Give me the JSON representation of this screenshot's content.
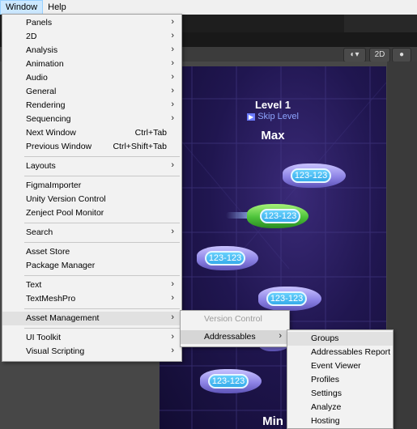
{
  "menubar": {
    "items": [
      "Window",
      "Help"
    ]
  },
  "toolbar": {
    "btn_2d": "2D"
  },
  "game": {
    "level_title": "Level 1",
    "skip_label": "Skip Level",
    "top_label": "Max",
    "bottom_label": "Min",
    "ship_labels": [
      "123-123",
      "123-123",
      "123-123",
      "123-123",
      "123-123"
    ]
  },
  "window_menu": {
    "items": [
      {
        "label": "Panels",
        "submenu": true
      },
      {
        "label": "2D",
        "submenu": true
      },
      {
        "label": "Analysis",
        "submenu": true
      },
      {
        "label": "Animation",
        "submenu": true
      },
      {
        "label": "Audio",
        "submenu": true
      },
      {
        "label": "General",
        "submenu": true
      },
      {
        "label": "Rendering",
        "submenu": true
      },
      {
        "label": "Sequencing",
        "submenu": true
      },
      {
        "label": "Next Window",
        "shortcut": "Ctrl+Tab"
      },
      {
        "label": "Previous Window",
        "shortcut": "Ctrl+Shift+Tab"
      },
      {
        "label": "Layouts",
        "submenu": true
      },
      {
        "label": "FigmaImporter"
      },
      {
        "label": "Unity Version Control"
      },
      {
        "label": "Zenject Pool Monitor"
      },
      {
        "label": "Search",
        "submenu": true
      },
      {
        "label": "Asset Store"
      },
      {
        "label": "Package Manager"
      },
      {
        "label": "Text",
        "submenu": true
      },
      {
        "label": "TextMeshPro",
        "submenu": true
      },
      {
        "label": "Asset Management",
        "submenu": true
      },
      {
        "label": "UI Toolkit",
        "submenu": true
      },
      {
        "label": "Visual Scripting",
        "submenu": true
      }
    ]
  },
  "asset_management_menu": {
    "items": [
      {
        "label": "Version Control",
        "disabled": true
      },
      {
        "label": "Addressables",
        "submenu": true
      }
    ]
  },
  "addressables_menu": {
    "items": [
      {
        "label": "Groups"
      },
      {
        "label": "Addressables Report"
      },
      {
        "label": "Event Viewer"
      },
      {
        "label": "Profiles"
      },
      {
        "label": "Settings"
      },
      {
        "label": "Analyze"
      },
      {
        "label": "Hosting"
      }
    ]
  },
  "icons": {
    "submenu_arrow": "›",
    "play": "▶"
  },
  "colors": {
    "menu_bg": "#f2f2f2",
    "highlight": "#e1e1e1",
    "game_bg": "#1b1245"
  }
}
